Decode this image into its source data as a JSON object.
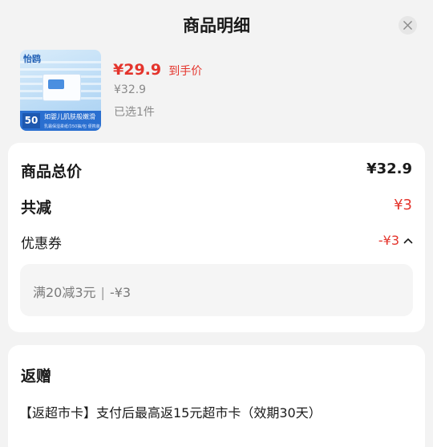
{
  "header": {
    "title": "商品明细"
  },
  "product": {
    "image": {
      "brand": "怡鸥",
      "count": "50",
      "tagline": "如婴儿肌肤般嫩滑",
      "subtag": "乳霜保湿柔纸巾50抽/包 便携装"
    },
    "price": "¥29.9",
    "price_tag": "到手价",
    "original_price": "¥32.9",
    "selected_text": "已选1件"
  },
  "summary": {
    "total_label": "商品总价",
    "total_value": "¥32.9",
    "reduction_label": "共减",
    "reduction_value": "¥3",
    "coupon_label": "优惠券",
    "coupon_value": "-¥3",
    "coupon_detail": {
      "condition": "满20减3元",
      "separator": "|",
      "amount": "-¥3"
    }
  },
  "gift": {
    "title": "返赠",
    "text": "【返超市卡】支付后最高返15元超市卡（效期30天）"
  },
  "colors": {
    "accent_red": "#e4342c",
    "muted_text": "#8a8a8a",
    "background": "#f3f3f3"
  }
}
